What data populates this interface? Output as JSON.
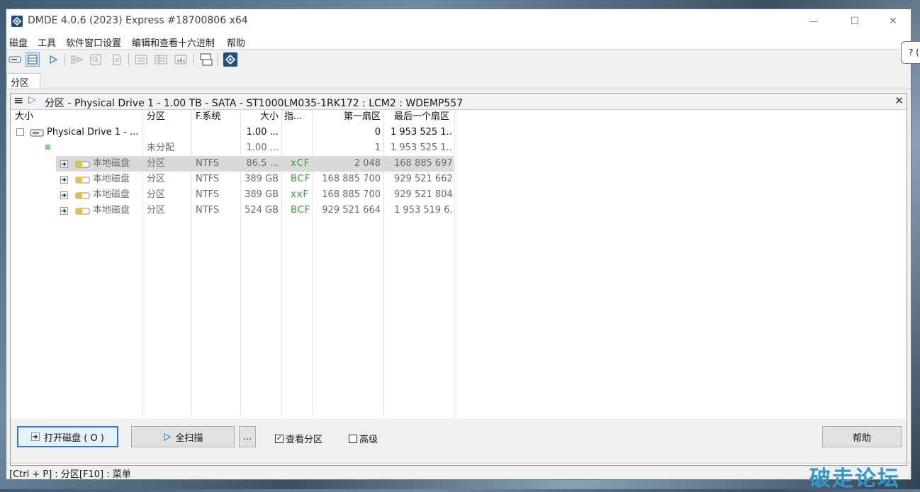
{
  "window": {
    "title": "DMDE 4.0.6 (2023) Express #18700806 x64",
    "minimize_glyph": "—",
    "maximize_glyph": "☐",
    "close_glyph": "✕"
  },
  "menu": [
    "磁盘",
    "工具",
    "软件窗口设置",
    "编辑和查看十六进制",
    "帮助"
  ],
  "toolbar": {
    "icons": [
      "disk-view-icon",
      "partitions-view-icon",
      "play-icon",
      "file-tree-icon",
      "search-icon",
      "document-icon",
      "list-icon",
      "details-icon",
      "image-icon",
      "window-split-icon",
      "dmde-logo-icon"
    ]
  },
  "tab": {
    "label": "分区"
  },
  "panel": {
    "menu_glyph": "≡",
    "play_glyph": "▷",
    "title": "分区 - Physical Drive 1 - 1.00 TB - SATA - ST1000LM035-1RK172 : LCM2 : WDEMP557",
    "close_glyph": "✕"
  },
  "table": {
    "headers": [
      "大小",
      "分区",
      "F.系统",
      "大小",
      "指...",
      "第一扇区",
      "最后一个扇区"
    ],
    "rows": [
      {
        "name": "Physical Drive 1 - ...",
        "kind": "",
        "fs": "",
        "size": "1.00 ...",
        "flags": "",
        "first": "0",
        "last": "1 953 525 1..."
      },
      {
        "name": "",
        "kind": "未分配",
        "fs": "",
        "size": "1.00 ...",
        "flags": "",
        "first": "1",
        "last": "1 953 525 1..."
      },
      {
        "name": "本地磁盘",
        "kind": "分区",
        "fs": "NTFS",
        "size": "86.5 ...",
        "flags": "xCF",
        "first": "2 048",
        "last": "168 885 697"
      },
      {
        "name": "本地磁盘",
        "kind": "分区",
        "fs": "NTFS",
        "size": "389 GB",
        "flags": "BCF",
        "first": "168 885 700",
        "last": "929 521 662"
      },
      {
        "name": "本地磁盘",
        "kind": "分区",
        "fs": "NTFS",
        "size": "389 GB",
        "flags": "xxF",
        "first": "168 885 700",
        "last": "929 521 804"
      },
      {
        "name": "本地磁盘",
        "kind": "分区",
        "fs": "NTFS",
        "size": "524 GB",
        "flags": "BCF",
        "first": "929 521 664",
        "last": "1 953 519 6..."
      }
    ]
  },
  "buttons": {
    "open_disk": "打开磁盘 ( O )",
    "full_scan": "全扫描",
    "more": "...",
    "help": "帮助"
  },
  "checkboxes": {
    "view_partitions": {
      "label": "查看分区",
      "checked": true,
      "mark": "✓"
    },
    "advanced": {
      "label": "高级",
      "checked": false
    }
  },
  "status": "[Ctrl + P] : 分区[F10] : 菜单",
  "tooltip": "? (",
  "watermark": "破走论坛",
  "colors": {
    "accent": "#2a78d0",
    "flag_green": "#2aa236",
    "selected_row": "#d9d9d9",
    "logo": "#1c4f86"
  }
}
